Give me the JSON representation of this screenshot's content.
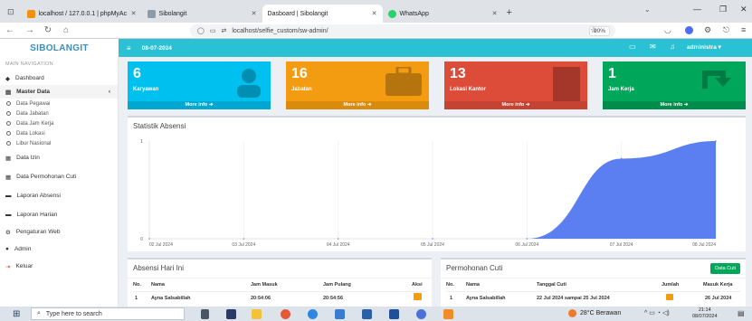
{
  "browser": {
    "tabs": [
      {
        "label": "localhost / 127.0.0.1 | phpMyAc",
        "color": "#f29111"
      },
      {
        "label": "Sibolangit",
        "color": "#8e9aa7"
      },
      {
        "label": "Dasboard | Sibolangit",
        "color": "#ffffff"
      },
      {
        "label": "WhatsApp",
        "color": "#25d366"
      }
    ],
    "url": "localhost/selfie_custom/sw-admin/",
    "zoom": "90%"
  },
  "header": {
    "brand": "SIBOLANGIT",
    "date": "08-07-2024",
    "user": "administra"
  },
  "sidebar": {
    "heading": "MAIN NAVIGATION",
    "items": [
      {
        "label": "Dashboard",
        "icon": "dashboard-icon"
      },
      {
        "label": "Master Data",
        "icon": "database-icon"
      }
    ],
    "sub": [
      "Data Pegawai",
      "Data Jabatan",
      "Data Jam Kerja",
      "Data Lokasi",
      "Libur Nasional"
    ],
    "items2": [
      {
        "label": "Data Izin",
        "icon": "calendar-icon"
      },
      {
        "label": "Data Permohonan Cuti",
        "icon": "calendar-icon"
      },
      {
        "label": "Laporan Absensi",
        "icon": "report-icon"
      },
      {
        "label": "Laporan Harian",
        "icon": "report-icon"
      },
      {
        "label": "Pengaturan Web",
        "icon": "cogs-icon"
      },
      {
        "label": "Admin",
        "icon": "user-icon"
      },
      {
        "label": "Keluar",
        "icon": "signout-icon"
      }
    ]
  },
  "boxes": [
    {
      "num": "6",
      "label": "Karyawan",
      "foot": "More info",
      "color": "#00c0ef",
      "foot_color": "#00a7d0"
    },
    {
      "num": "16",
      "label": "Jabatan",
      "foot": "More info",
      "color": "#f39c12",
      "foot_color": "#db8b0b"
    },
    {
      "num": "13",
      "label": "Lokasi Kantor",
      "foot": "More info",
      "color": "#dd4b39",
      "foot_color": "#c64333"
    },
    {
      "num": "1",
      "label": "Jam Kerja",
      "foot": "More info",
      "color": "#00a65a",
      "foot_color": "#008d4c"
    }
  ],
  "chart_title": "Statistik Absensi",
  "chart_data": {
    "type": "area",
    "title": "Statistik Absensi",
    "x": [
      "02 Jul 2024",
      "03 Jul 2024",
      "04 Jul 2024",
      "05 Jul 2024",
      "06 Jul 2024",
      "07 Jul 2024",
      "08 Jul 2024"
    ],
    "values": [
      0,
      0,
      0,
      0,
      0,
      0.82,
      1
    ],
    "ylim": [
      0,
      1
    ],
    "yticks": [
      "1",
      "0"
    ],
    "color": "#5b7ff0"
  },
  "absensi": {
    "title": "Absensi Hari Ini",
    "headers": [
      "No.",
      "Nama",
      "Jam Masuk",
      "Jam Pulang",
      "Aksi"
    ],
    "rows": [
      [
        "1",
        "Ayna Salsabillah",
        "20:54:06",
        "20:54:56"
      ]
    ]
  },
  "cuti": {
    "title": "Permohonan Cuti",
    "button": "Data Cuti",
    "headers": [
      "No.",
      "Nama",
      "Tanggal Cuti",
      "Jumlah",
      "Masuk Kerja"
    ],
    "rows": [
      [
        "1",
        "Ayna Salsabillah",
        "22 Jul 2024 sampai 25 Jul 2024",
        "",
        "26 Jul 2024"
      ]
    ]
  },
  "taskbar": {
    "search": "Type here to search",
    "weather": "28°C  Berawan",
    "time": "21:14",
    "date": "08/07/2024"
  }
}
